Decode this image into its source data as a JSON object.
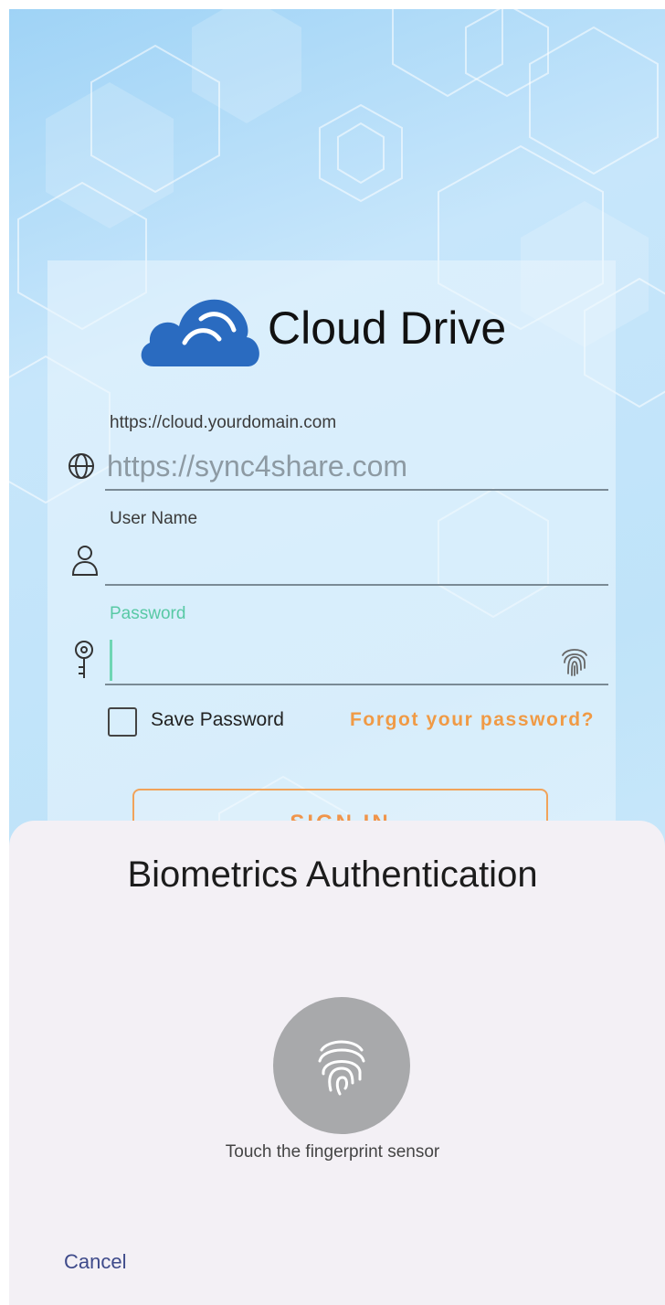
{
  "app": {
    "brand_name": "Cloud Drive",
    "brand_color": "#2a6bc0"
  },
  "login": {
    "server_label": "https://cloud.yourdomain.com",
    "server_value": "https://sync4share.com",
    "username_label": "User Name",
    "username_value": "",
    "password_label": "Password",
    "password_label_color": "#58c9a5",
    "password_value": "",
    "save_password_label": "Save Password",
    "save_password_checked": false,
    "forgot_link": "Forgot your password?",
    "sign_in_label": "SIGN IN"
  },
  "biometrics": {
    "title": "Biometrics Authentication",
    "hint": "Touch the fingerprint sensor",
    "cancel_label": "Cancel"
  },
  "icons": [
    "globe-icon",
    "user-icon",
    "key-icon",
    "fingerprint-icon",
    "cloud-logo-icon"
  ]
}
